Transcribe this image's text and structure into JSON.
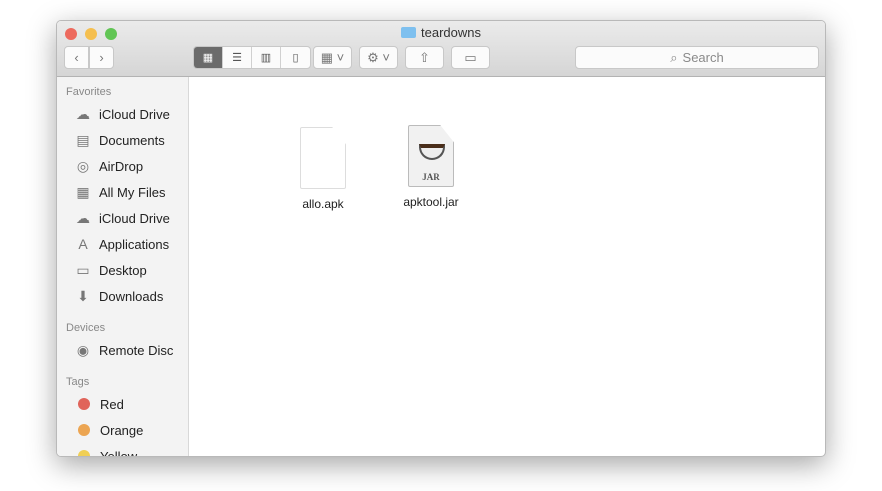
{
  "window": {
    "title": "teardowns"
  },
  "toolbar": {
    "search_placeholder": "Search",
    "colors": {
      "close": "#ed6a5e",
      "minimize": "#f5bf4f",
      "zoom": "#61c554"
    }
  },
  "sidebar": {
    "favorites_label": "Favorites",
    "favorites": [
      {
        "label": "iCloud Drive",
        "icon": "cloud-icon",
        "glyph": "☁"
      },
      {
        "label": "Documents",
        "icon": "documents-icon",
        "glyph": "▤"
      },
      {
        "label": "AirDrop",
        "icon": "airdrop-icon",
        "glyph": "◎"
      },
      {
        "label": "All My Files",
        "icon": "all-files-icon",
        "glyph": "▦"
      },
      {
        "label": "iCloud Drive",
        "icon": "cloud-icon",
        "glyph": "☁"
      },
      {
        "label": "Applications",
        "icon": "applications-icon",
        "glyph": "A"
      },
      {
        "label": "Desktop",
        "icon": "desktop-icon",
        "glyph": "▭"
      },
      {
        "label": "Downloads",
        "icon": "downloads-icon",
        "glyph": "⬇"
      }
    ],
    "devices_label": "Devices",
    "devices": [
      {
        "label": "Remote Disc",
        "icon": "disc-icon",
        "glyph": "◉"
      }
    ],
    "tags_label": "Tags",
    "tags": [
      {
        "label": "Red",
        "color": "#e0645a"
      },
      {
        "label": "Orange",
        "color": "#eca552"
      },
      {
        "label": "Yellow",
        "color": "#f0cf55"
      }
    ]
  },
  "files": [
    {
      "name": "allo.apk",
      "type": "generic"
    },
    {
      "name": "apktool.jar",
      "type": "jar",
      "badge": "JAR"
    }
  ]
}
